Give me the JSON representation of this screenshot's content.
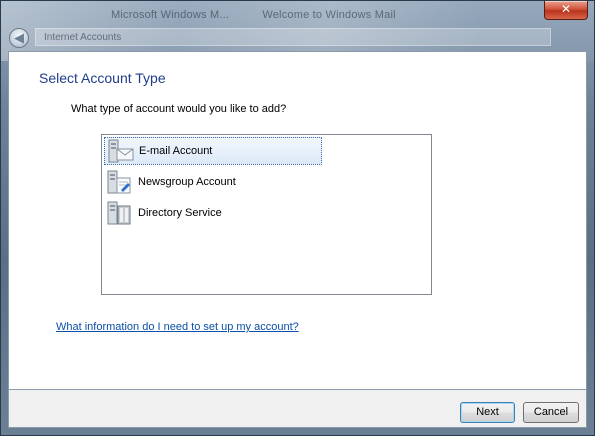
{
  "window": {
    "ghost_tabs": [
      "Microsoft Windows M...",
      "Welcome to Windows Mail"
    ],
    "ghost_title": "Internet Accounts",
    "close_glyph": "✕",
    "back_glyph": "◀"
  },
  "wizard": {
    "title": "Select Account Type",
    "prompt": "What type of account would you like to add?",
    "items": [
      {
        "label": "E-mail Account",
        "icon": "email-account-icon",
        "selected": true
      },
      {
        "label": "Newsgroup Account",
        "icon": "newsgroup-account-icon",
        "selected": false
      },
      {
        "label": "Directory Service",
        "icon": "directory-service-icon",
        "selected": false
      }
    ],
    "help_link": "What information do I need to set up my account?"
  },
  "buttons": {
    "next": "Next",
    "cancel": "Cancel"
  },
  "colors": {
    "title": "#1f3d8a",
    "link": "#0b4fa8",
    "selection": "#dde9f8",
    "close": "#c8452b"
  }
}
